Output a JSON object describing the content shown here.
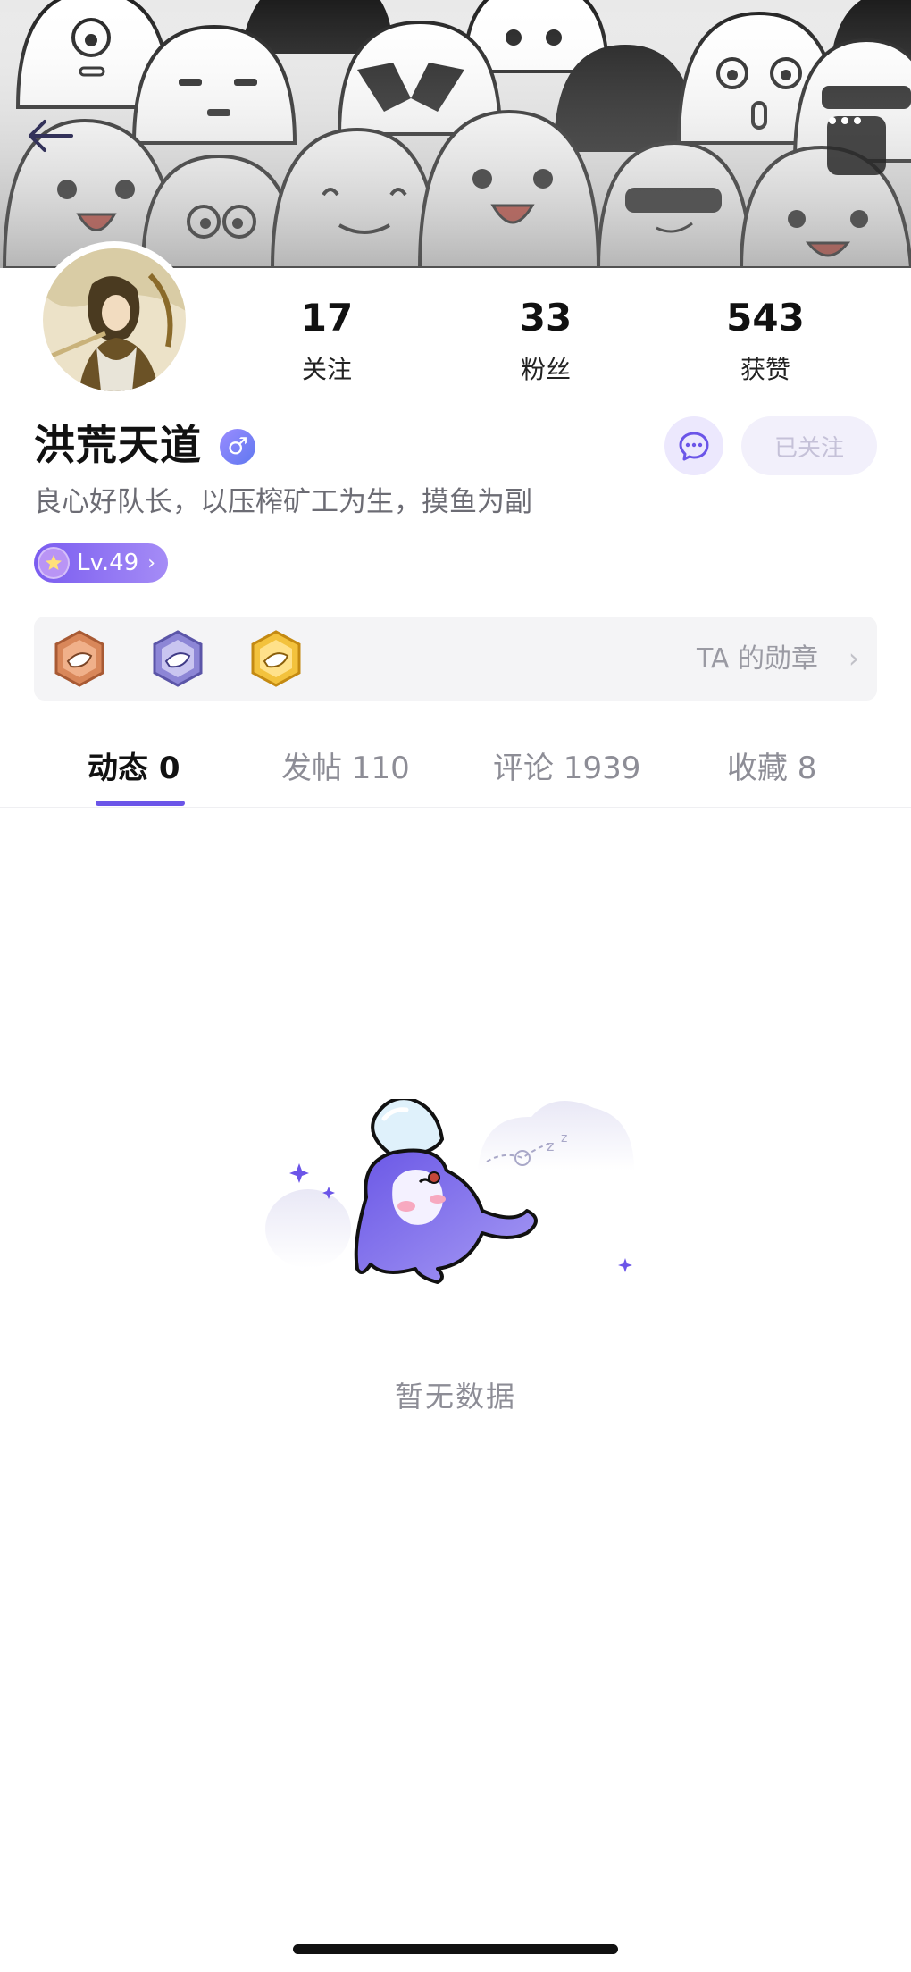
{
  "header": {
    "back_icon": "back-arrow-icon",
    "more_icon": "more-dots-icon"
  },
  "profile": {
    "name": "洪荒天道",
    "gender_symbol": "♂",
    "bio": "良心好队长，以压榨矿工为生，摸鱼为副",
    "level_label": "Lv.49",
    "follow_button": "已关注"
  },
  "stats": [
    {
      "value": "17",
      "label": "关注"
    },
    {
      "value": "33",
      "label": "粉丝"
    },
    {
      "value": "543",
      "label": "获赞"
    }
  ],
  "medals": {
    "label": "TA 的勋章",
    "items": [
      "bronze-medal-icon",
      "purple-medal-icon",
      "gold-medal-icon"
    ]
  },
  "tabs": [
    {
      "label": "动态 0",
      "active": true
    },
    {
      "label": "发帖 110",
      "active": false
    },
    {
      "label": "评论 1939",
      "active": false
    },
    {
      "label": "收藏 8",
      "active": false
    }
  ],
  "empty_state": {
    "text": "暂无数据"
  },
  "colors": {
    "accent": "#6b55e8",
    "level_start": "#7a5cf0",
    "level_end": "#a58cf6",
    "chat_bg": "#ece8fd"
  }
}
